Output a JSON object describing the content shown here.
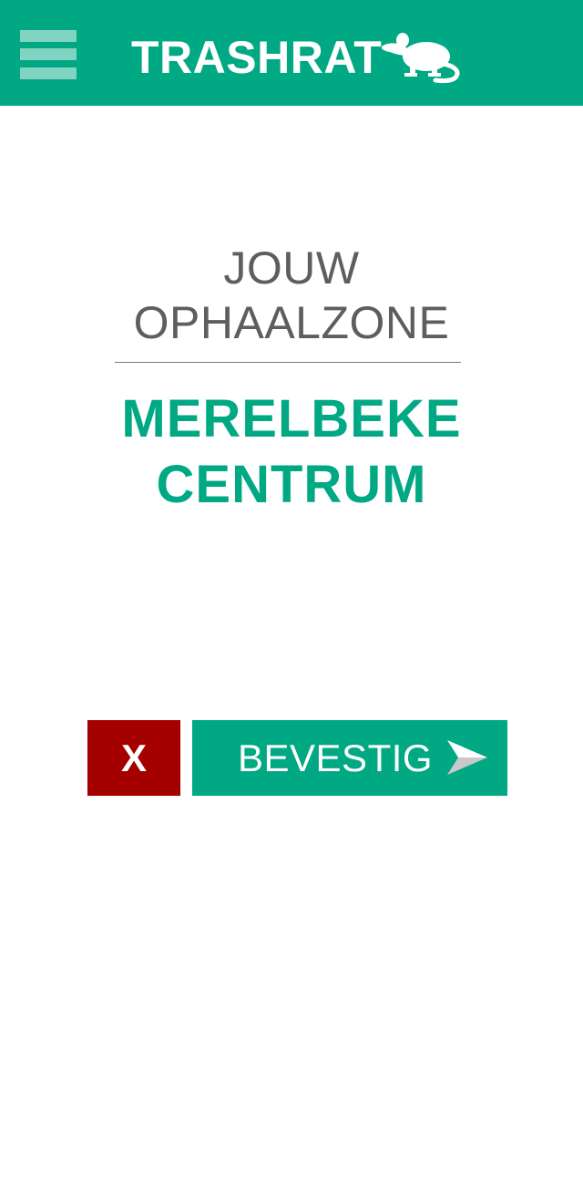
{
  "header": {
    "title": "TRASHRAT",
    "menu_icon": "hamburger-menu-icon",
    "logo_icon": "rat-icon",
    "background": "#00a883"
  },
  "zone": {
    "heading_line1": "JOUW",
    "heading_line2": "OPHAALZONE",
    "name_line1": "MERELBEKE",
    "name_line2": "CENTRUM"
  },
  "actions": {
    "cancel_label": "X",
    "cancel_color": "#a40000",
    "confirm_label": "BEVESTIG",
    "confirm_icon": "send-arrow-icon",
    "confirm_color": "#00a883"
  }
}
